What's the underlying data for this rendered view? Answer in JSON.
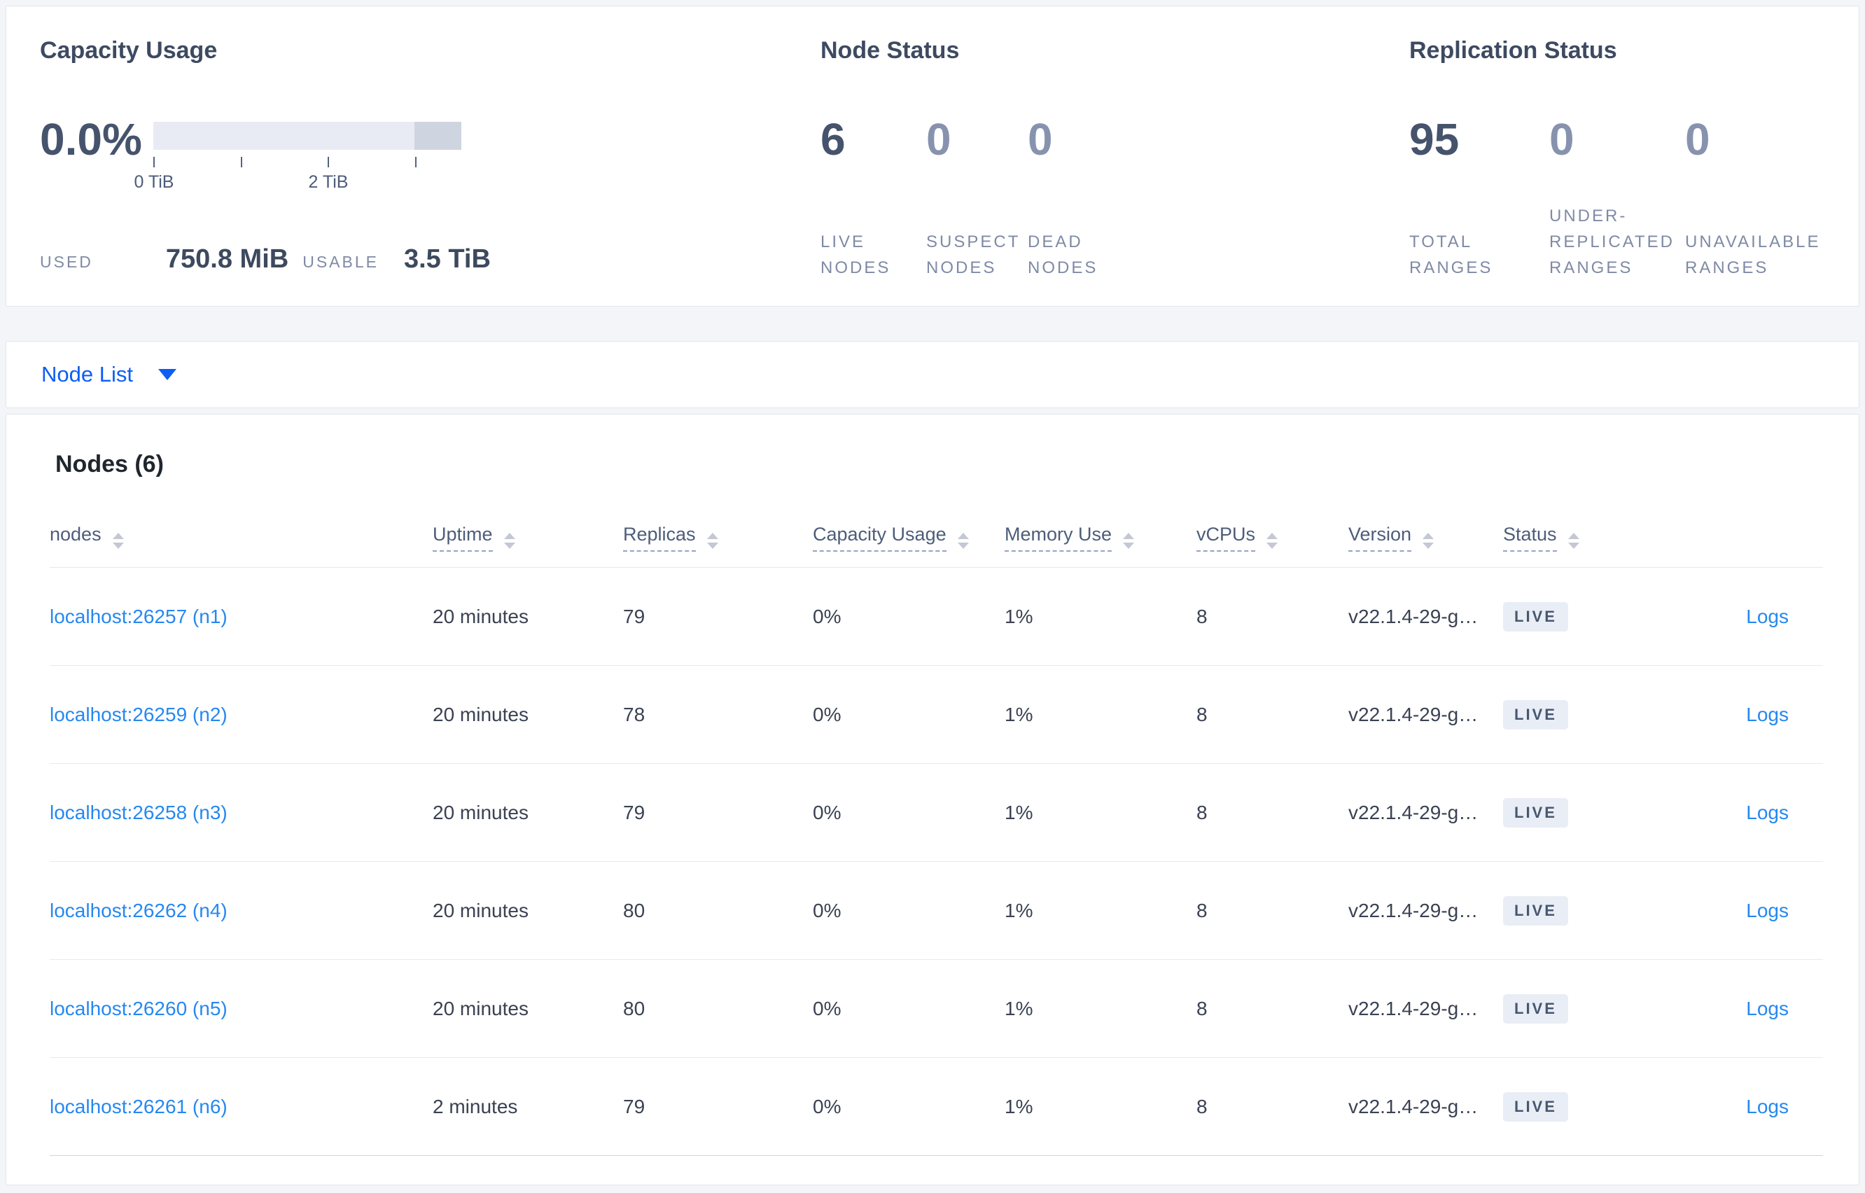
{
  "summary": {
    "capacity_usage": {
      "title": "Capacity Usage",
      "percent": "0.0%",
      "tick_labels": [
        "0 TiB",
        "2 TiB"
      ],
      "used_label": "USED",
      "used_value": "750.8 MiB",
      "usable_label": "USABLE",
      "usable_value": "3.5 TiB"
    },
    "node_status": {
      "title": "Node Status",
      "stats": [
        {
          "value": "6",
          "label": "LIVE NODES"
        },
        {
          "value": "0",
          "label": "SUSPECT NODES"
        },
        {
          "value": "0",
          "label": "DEAD NODES"
        }
      ]
    },
    "replication_status": {
      "title": "Replication Status",
      "stats": [
        {
          "value": "95",
          "label": "TOTAL RANGES"
        },
        {
          "value": "0",
          "label": "UNDER-REPLICATED RANGES"
        },
        {
          "value": "0",
          "label": "UNAVAILABLE RANGES"
        }
      ]
    }
  },
  "node_list_dropdown": {
    "label": "Node List"
  },
  "nodes_table": {
    "title": "Nodes (6)",
    "columns": [
      "nodes",
      "Uptime",
      "Replicas",
      "Capacity Usage",
      "Memory Use",
      "vCPUs",
      "Version",
      "Status"
    ],
    "logs_label": "Logs",
    "rows": [
      {
        "node": "localhost:26257 (n1)",
        "uptime": "20 minutes",
        "replicas": "79",
        "capacity_usage": "0%",
        "memory_use": "1%",
        "vcpus": "8",
        "version": "v22.1.4-29-g…",
        "status": "LIVE"
      },
      {
        "node": "localhost:26259 (n2)",
        "uptime": "20 minutes",
        "replicas": "78",
        "capacity_usage": "0%",
        "memory_use": "1%",
        "vcpus": "8",
        "version": "v22.1.4-29-g…",
        "status": "LIVE"
      },
      {
        "node": "localhost:26258 (n3)",
        "uptime": "20 minutes",
        "replicas": "79",
        "capacity_usage": "0%",
        "memory_use": "1%",
        "vcpus": "8",
        "version": "v22.1.4-29-g…",
        "status": "LIVE"
      },
      {
        "node": "localhost:26262 (n4)",
        "uptime": "20 minutes",
        "replicas": "80",
        "capacity_usage": "0%",
        "memory_use": "1%",
        "vcpus": "8",
        "version": "v22.1.4-29-g…",
        "status": "LIVE"
      },
      {
        "node": "localhost:26260 (n5)",
        "uptime": "20 minutes",
        "replicas": "80",
        "capacity_usage": "0%",
        "memory_use": "1%",
        "vcpus": "8",
        "version": "v22.1.4-29-g…",
        "status": "LIVE"
      },
      {
        "node": "localhost:26261 (n6)",
        "uptime": "2 minutes",
        "replicas": "79",
        "capacity_usage": "0%",
        "memory_use": "1%",
        "vcpus": "8",
        "version": "v22.1.4-29-g…",
        "status": "LIVE"
      }
    ]
  },
  "colors": {
    "page_background": "#f4f5f9",
    "card_border": "#e2e5ec",
    "primary_number": "#46536c",
    "muted_number": "#8793ae",
    "muted_label": "#7f8aa5",
    "dropdown_blue": "#0d5ef5",
    "link_blue": "#2688f0",
    "bar_light": "#e9ebf4",
    "bar_dark": "#cfd4e1",
    "badge_background": "#e9edf5",
    "badge_text": "#475770"
  }
}
